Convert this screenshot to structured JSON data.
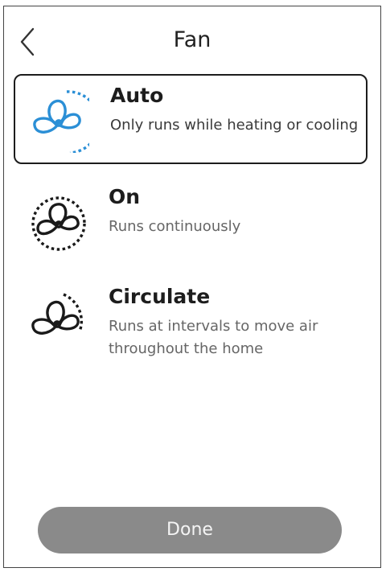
{
  "header": {
    "title": "Fan",
    "back_icon": "chevron-left-icon"
  },
  "options": [
    {
      "label": "Auto",
      "description": "Only runs while heating or cooling",
      "icon": "fan-auto-icon",
      "selected": true,
      "icon_color": "#2b8fd6"
    },
    {
      "label": "On",
      "description": "Runs continuously",
      "icon": "fan-on-icon",
      "selected": false,
      "icon_color": "#1a1a1a"
    },
    {
      "label": "Circulate",
      "description": "Runs at intervals to move air throughout the home",
      "icon": "fan-circulate-icon",
      "selected": false,
      "icon_color": "#1a1a1a"
    }
  ],
  "footer": {
    "done_label": "Done",
    "done_color": "#8a8a8a"
  }
}
